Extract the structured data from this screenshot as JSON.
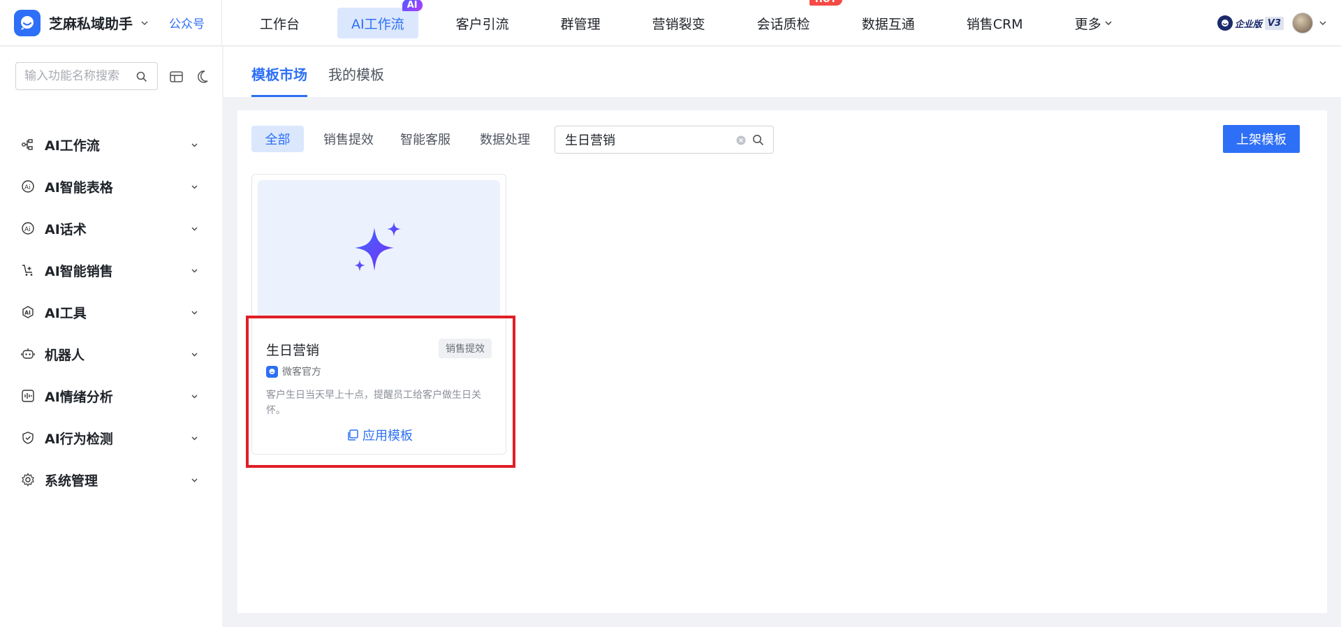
{
  "brand": {
    "name": "芝麻私域助手",
    "link": "公众号"
  },
  "topnav": [
    {
      "label": "工作台",
      "active": false
    },
    {
      "label": "AI工作流",
      "active": true,
      "badge": "AI"
    },
    {
      "label": "客户引流",
      "active": false
    },
    {
      "label": "群管理",
      "active": false
    },
    {
      "label": "营销裂变",
      "active": false
    },
    {
      "label": "会话质检",
      "active": false,
      "badge": "HOT"
    },
    {
      "label": "数据互通",
      "active": false
    },
    {
      "label": "销售CRM",
      "active": false
    },
    {
      "label": "更多",
      "active": false
    }
  ],
  "account": {
    "edition": "企业版",
    "version": "V3"
  },
  "sidebar": {
    "search_placeholder": "输入功能名称搜索",
    "items": [
      {
        "label": "AI工作流",
        "icon": "workflow-icon"
      },
      {
        "label": "AI智能表格",
        "icon": "ai-table-icon"
      },
      {
        "label": "AI话术",
        "icon": "ai-script-icon"
      },
      {
        "label": "AI智能销售",
        "icon": "cart-icon"
      },
      {
        "label": "AI工具",
        "icon": "ai-tool-icon"
      },
      {
        "label": "机器人",
        "icon": "robot-icon"
      },
      {
        "label": "AI情绪分析",
        "icon": "emotion-chart-icon"
      },
      {
        "label": "AI行为检测",
        "icon": "shield-check-icon"
      },
      {
        "label": "系统管理",
        "icon": "gear-icon"
      }
    ]
  },
  "tabs": [
    {
      "label": "模板市场",
      "active": true
    },
    {
      "label": "我的模板",
      "active": false
    }
  ],
  "filters": [
    {
      "label": "全部",
      "active": true
    },
    {
      "label": "销售提效",
      "active": false
    },
    {
      "label": "智能客服",
      "active": false
    },
    {
      "label": "数据处理",
      "active": false
    }
  ],
  "search": {
    "value": "生日营销"
  },
  "publish_label": "上架模板",
  "card": {
    "title": "生日营销",
    "tag": "销售提效",
    "author": "微客官方",
    "desc": "客户生日当天早上十点，提醒员工给客户做生日关怀。",
    "apply_label": "应用模板"
  },
  "colors": {
    "primary": "#2d6ff6",
    "highlight": "#e01e26",
    "hot": "#f54a45"
  }
}
